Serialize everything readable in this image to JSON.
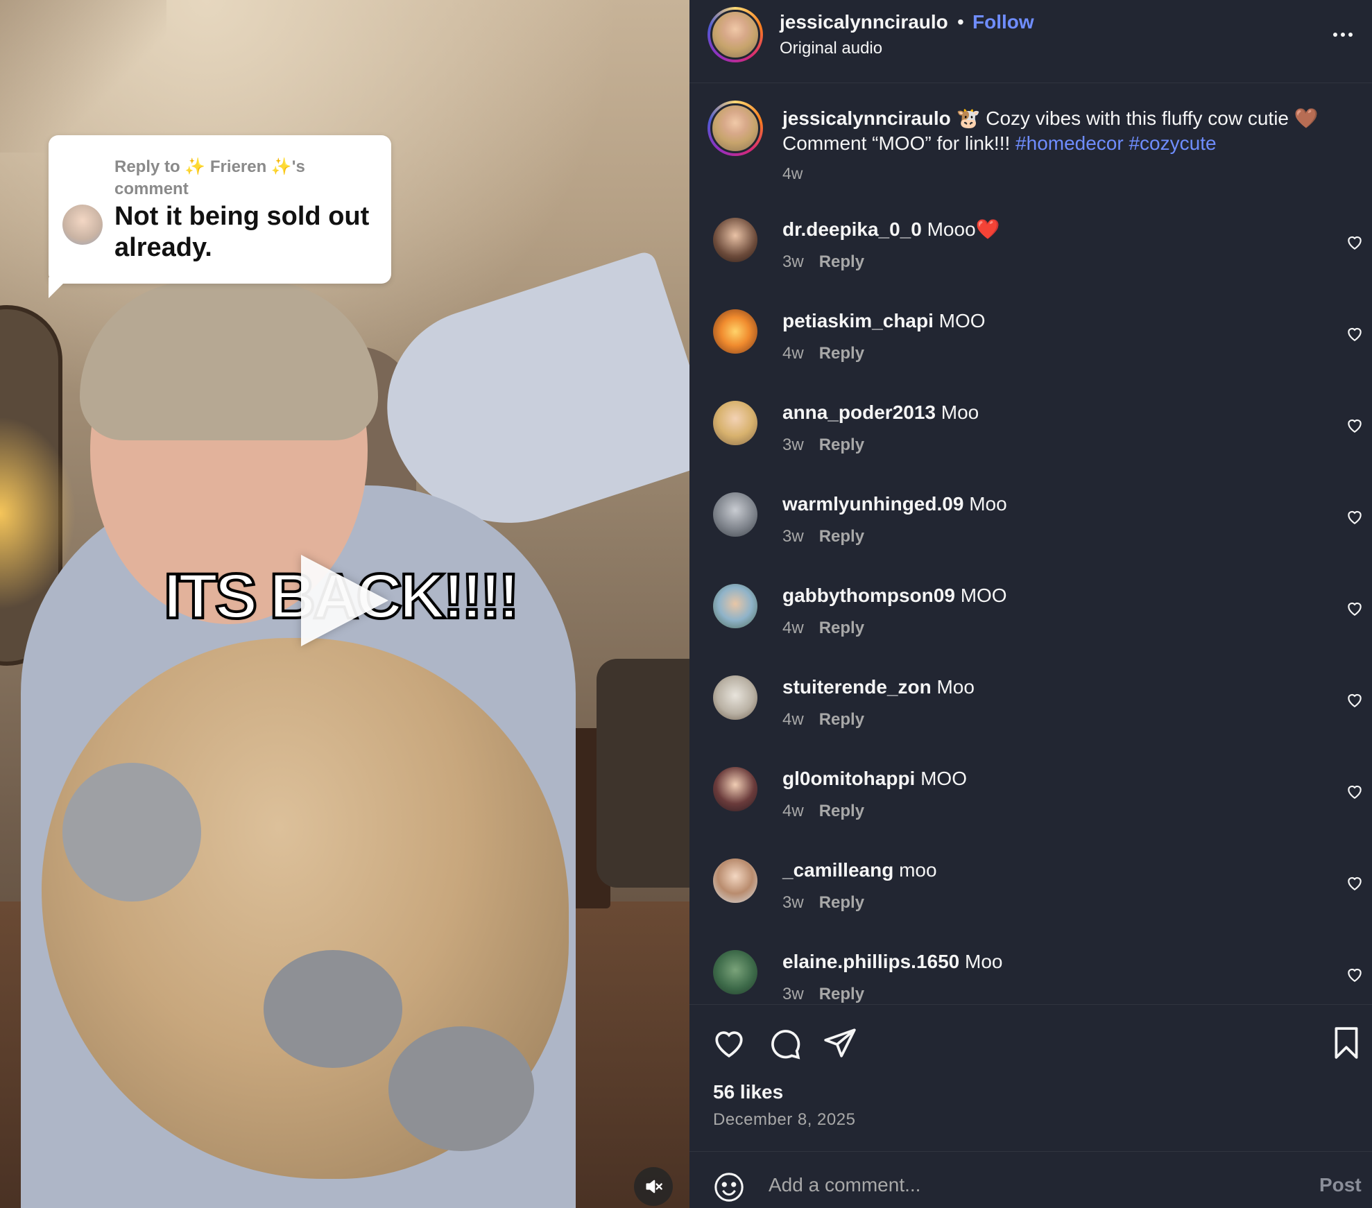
{
  "video": {
    "reply_label": "Reply to ✨ Frieren ✨'s comment",
    "reply_text": "Not it being sold out already.",
    "overlay_text": "ITS BACK!!!!"
  },
  "header": {
    "username": "jessicalynnciraulo",
    "separator": "•",
    "follow_label": "Follow",
    "audio_label": "Original audio"
  },
  "caption": {
    "username": "jessicalynnciraulo",
    "text": "🐮 Cozy vibes with this fluffy cow cutie 🤎 Comment “MOO” for link!!! ",
    "hashtag1": "#homedecor",
    "hashtag2": "#cozycute",
    "time": "4w"
  },
  "comments": [
    {
      "username": "dr.deepika_0_0",
      "text": "Mooo❤️",
      "time": "3w",
      "reply": "Reply"
    },
    {
      "username": "petiaskim_chapi",
      "text": "MOO",
      "time": "4w",
      "reply": "Reply"
    },
    {
      "username": "anna_poder2013",
      "text": "Moo",
      "time": "3w",
      "reply": "Reply"
    },
    {
      "username": "warmlyunhinged.09",
      "text": "Moo",
      "time": "3w",
      "reply": "Reply"
    },
    {
      "username": "gabbythompson09",
      "text": "MOO",
      "time": "4w",
      "reply": "Reply"
    },
    {
      "username": "stuiterende_zon",
      "text": "Moo",
      "time": "4w",
      "reply": "Reply"
    },
    {
      "username": "gl0omitohappi",
      "text": "MOO",
      "time": "4w",
      "reply": "Reply"
    },
    {
      "username": "_camilleang",
      "text": "moo",
      "time": "3w",
      "reply": "Reply"
    },
    {
      "username": "elaine.phillips.1650",
      "text": "Moo",
      "time": "3w",
      "reply": "Reply"
    }
  ],
  "engagement": {
    "likes": "56 likes",
    "date": "December 8, 2025"
  },
  "composer": {
    "placeholder": "Add a comment...",
    "post_label": "Post"
  },
  "icons": {
    "like": "heart-icon",
    "comment": "comment-bubble-icon",
    "share": "paper-plane-icon",
    "save": "bookmark-icon",
    "emoji": "smiley-icon",
    "mute": "muted-speaker-icon",
    "more": "more-options-icon",
    "play": "play-icon"
  },
  "colors": {
    "panel_bg": "#222632",
    "link": "#6f8dff",
    "muted_text": "#a8a8a8"
  }
}
